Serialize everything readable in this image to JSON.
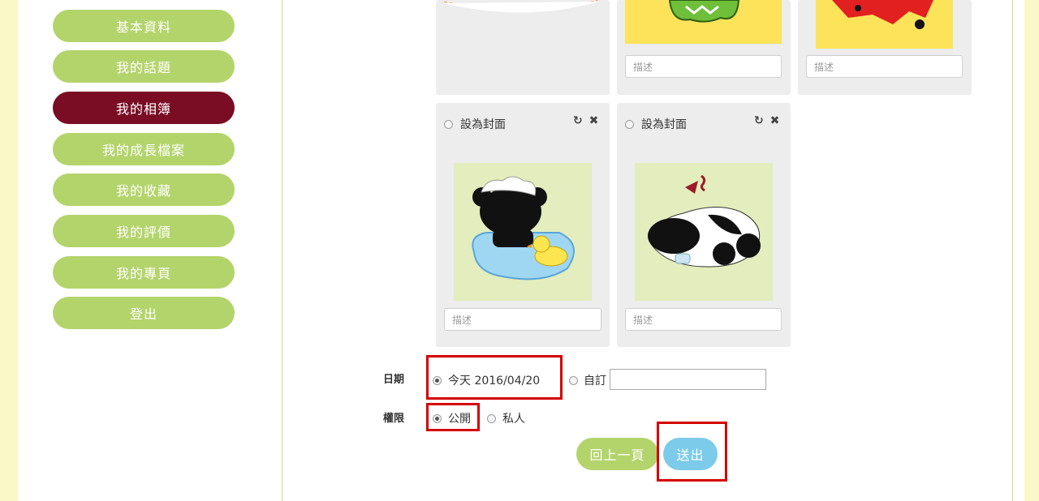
{
  "sidebar": {
    "items": [
      {
        "label": "基本資料"
      },
      {
        "label": "我的話題"
      },
      {
        "label": "我的相簿"
      },
      {
        "label": "我的成長檔案"
      },
      {
        "label": "我的收藏"
      },
      {
        "label": "我的評價"
      },
      {
        "label": "我的專頁"
      },
      {
        "label": "登出"
      }
    ],
    "active_index": 2
  },
  "album": {
    "description_placeholder": "描述",
    "cover_label": "設為封面",
    "refresh_glyph": "↻",
    "remove_glyph": "✖"
  },
  "form": {
    "date_label": "日期",
    "today_option": "今天 2016/04/20",
    "custom_option": "自訂",
    "custom_value": "",
    "permission_label": "權限",
    "public_option": "公開",
    "private_option": "私人"
  },
  "actions": {
    "back_label": "回上一頁",
    "submit_label": "送出"
  },
  "colors": {
    "page_background": "#fbf8c8",
    "sidebar_button": "#b3d46b",
    "sidebar_active": "#7a0d24",
    "submit_button": "#7ccbea",
    "highlight_box": "#d40000",
    "thumbnail_bg": "#e3edbd"
  },
  "icons": [
    "refresh-icon",
    "close-icon"
  ]
}
